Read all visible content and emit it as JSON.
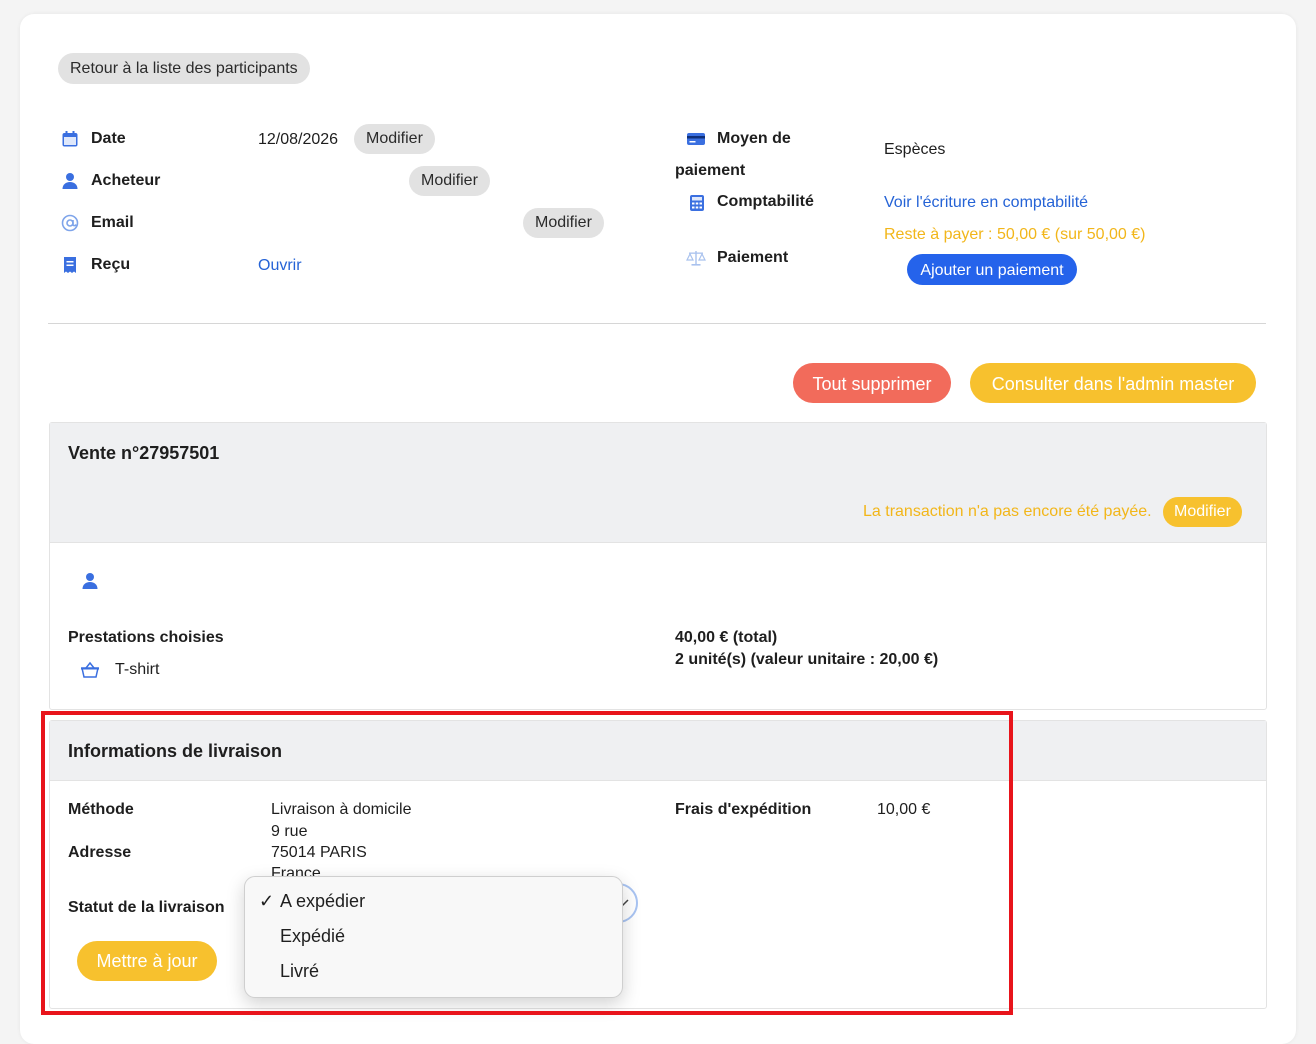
{
  "back_button": "Retour à la liste des participants",
  "info": {
    "date_label": "Date",
    "date_value": "12/08/2026",
    "buyer_label": "Acheteur",
    "email_label": "Email",
    "receipt_label": "Reçu",
    "receipt_link": "Ouvrir",
    "modify": "Modifier",
    "payment_method_label_line1": "Moyen de",
    "payment_method_label_line2": "paiement",
    "payment_method_value": "Espèces",
    "accounting_label": "Comptabilité",
    "accounting_link": "Voir l'écriture en comptabilité",
    "payment_label": "Paiement",
    "remaining": "Reste à payer : 50,00 € (sur 50,00 €)",
    "add_payment": "Ajouter un paiement"
  },
  "actions": {
    "delete_all": "Tout supprimer",
    "admin_master": "Consulter dans l'admin master"
  },
  "sale": {
    "title": "Vente n°27957501",
    "unpaid_notice": "La transaction n'a pas encore été payée.",
    "modify": "Modifier",
    "services_label": "Prestations choisies",
    "item_name": "T-shirt",
    "total": "40,00 € (total)",
    "units": "2 unité(s) (valeur unitaire : 20,00 €)"
  },
  "delivery": {
    "title": "Informations de livraison",
    "method_label": "Méthode",
    "method_value": "Livraison à domicile",
    "address_label": "Adresse",
    "address_line1": "9 rue",
    "address_line2": "75014 PARIS",
    "address_line3": "France",
    "shipping_label": "Frais d'expédition",
    "shipping_value": "10,00 €",
    "status_label": "Statut de la livraison",
    "update_button": "Mettre à jour",
    "options": [
      "A expédier",
      "Expédié",
      "Livré"
    ],
    "checkmark": "✓"
  },
  "colors": {
    "accent_blue": "#2563eb",
    "warning_orange": "#f2b61a",
    "danger_red": "#f26b5b",
    "highlight_frame": "#e8141b"
  }
}
